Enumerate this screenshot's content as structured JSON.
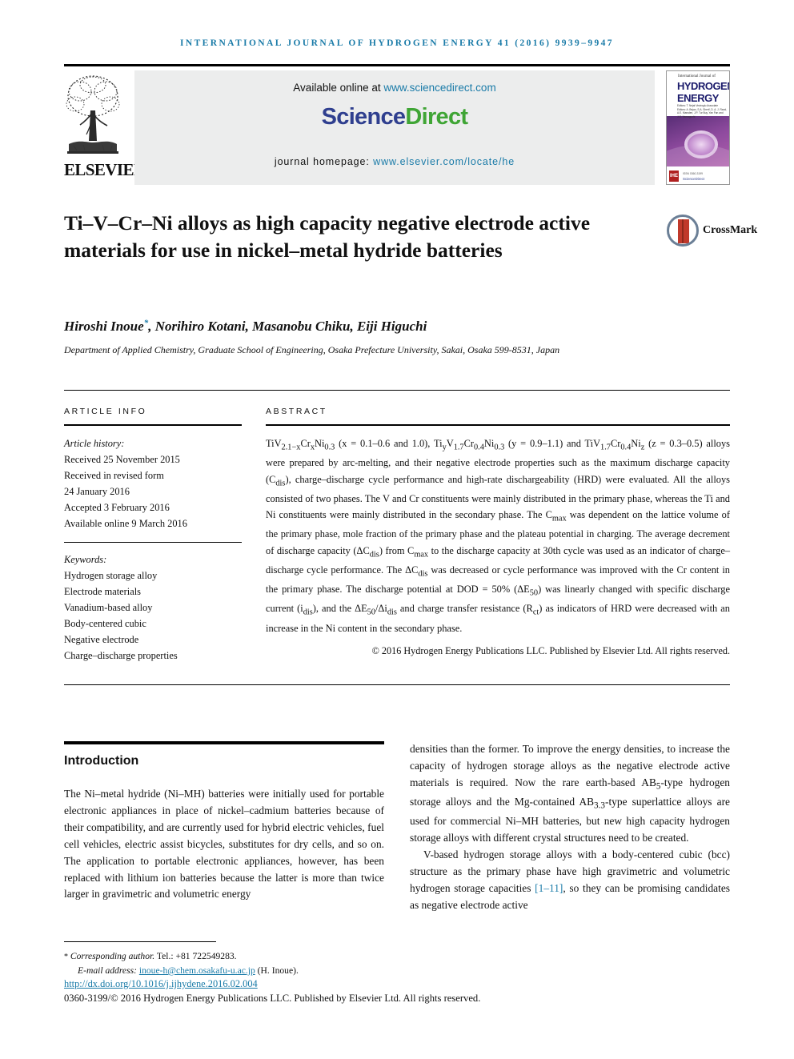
{
  "running_head": "International Journal of Hydrogen Energy 41 (2016) 9939–9947",
  "banner": {
    "publisher": "ELSEVIER",
    "available_text": "Available online at ",
    "available_url": "www.sciencedirect.com",
    "logo_part1": "Science",
    "logo_part2": "Direct",
    "homepage_label": "journal homepage: ",
    "homepage_url": "www.elsevier.com/locate/he",
    "cover": {
      "kicker": "International Journal of",
      "line1": "HYDROGEN",
      "line2": "ENERGY",
      "editors": "Editors: T. Nejat Veziroglu\nAssociate Editors: A. Bejan, S.A. Sherif, D. A. J. Rand, A.E. Marsden, J.P. Tur Buy, Yan Fan and J.O. Yamaguchi",
      "issn_text": "ISSN 0360-3199",
      "sd_text": "ScienceDirect",
      "badge": "IHE"
    }
  },
  "article": {
    "title": "Ti–V–Cr–Ni alloys as high capacity negative electrode active materials for use in nickel–metal hydride batteries",
    "crossmark_label": "CrossMark",
    "authors": "Hiroshi Inoue, Norihiro Kotani, Masanobu Chiku, Eiji Higuchi",
    "corresponding_marker": "*",
    "affiliation": "Department of Applied Chemistry, Graduate School of Engineering, Osaka Prefecture University, Sakai, Osaka 599-8531, Japan"
  },
  "article_info": {
    "heading": "Article info",
    "history_label": "Article history:",
    "history": [
      "Received 25 November 2015",
      "Received in revised form",
      "24 January 2016",
      "Accepted 3 February 2016",
      "Available online 9 March 2016"
    ],
    "keywords_label": "Keywords:",
    "keywords": [
      "Hydrogen storage alloy",
      "Electrode materials",
      "Vanadium-based alloy",
      "Body-centered cubic",
      "Negative electrode",
      "Charge–discharge properties"
    ]
  },
  "abstract": {
    "heading": "Abstract",
    "text_segments": [
      {
        "t": "TiV"
      },
      {
        "t": "2.1−x",
        "s": "sub"
      },
      {
        "t": "Cr"
      },
      {
        "t": "x",
        "s": "sub"
      },
      {
        "t": "Ni"
      },
      {
        "t": "0.3",
        "s": "sub"
      },
      {
        "t": " (x = 0.1–0.6 and 1.0), Ti"
      },
      {
        "t": "y",
        "s": "sub"
      },
      {
        "t": "V"
      },
      {
        "t": "1.7",
        "s": "sub"
      },
      {
        "t": "Cr"
      },
      {
        "t": "0.4",
        "s": "sub"
      },
      {
        "t": "Ni"
      },
      {
        "t": "0.3",
        "s": "sub"
      },
      {
        "t": " (y = 0.9–1.1) and TiV"
      },
      {
        "t": "1.7",
        "s": "sub"
      },
      {
        "t": "Cr"
      },
      {
        "t": "0.4",
        "s": "sub"
      },
      {
        "t": "Ni"
      },
      {
        "t": "z",
        "s": "sub"
      },
      {
        "t": " (z = 0.3–0.5) alloys were prepared by arc-melting, and their negative electrode properties such as the maximum discharge capacity (C"
      },
      {
        "t": "dis",
        "s": "sub"
      },
      {
        "t": "), charge–discharge cycle performance and high-rate dischargeability (HRD) were evaluated. All the alloys consisted of two phases. The V and Cr constituents were mainly distributed in the primary phase, whereas the Ti and Ni constituents were mainly distributed in the secondary phase. The C"
      },
      {
        "t": "max",
        "s": "sub"
      },
      {
        "t": " was dependent on the lattice volume of the primary phase, mole fraction of the primary phase and the plateau potential in charging. The average decrement of discharge capacity (ΔC"
      },
      {
        "t": "dis",
        "s": "sub"
      },
      {
        "t": ") from C"
      },
      {
        "t": "max",
        "s": "sub"
      },
      {
        "t": " to the discharge capacity at 30th cycle was used as an indicator of charge–discharge cycle performance. The ΔC"
      },
      {
        "t": "dis",
        "s": "sub"
      },
      {
        "t": " was decreased or cycle performance was improved with the Cr content in the primary phase. The discharge potential at DOD = 50% (ΔE"
      },
      {
        "t": "50",
        "s": "sub"
      },
      {
        "t": ") was linearly changed with specific discharge current (i"
      },
      {
        "t": "dis",
        "s": "sub"
      },
      {
        "t": "), and the ΔE"
      },
      {
        "t": "50",
        "s": "sub"
      },
      {
        "t": "/Δi"
      },
      {
        "t": "dis",
        "s": "sub"
      },
      {
        "t": " and charge transfer resistance (R"
      },
      {
        "t": "ct",
        "s": "sub"
      },
      {
        "t": ") as indicators of HRD were decreased with an increase in the Ni content in the secondary phase."
      }
    ],
    "copyright": "© 2016 Hydrogen Energy Publications LLC. Published by Elsevier Ltd. All rights reserved."
  },
  "body": {
    "intro_heading": "Introduction",
    "left_paragraph": "The Ni–metal hydride (Ni–MH) batteries were initially used for portable electronic appliances in place of nickel–cadmium batteries because of their compatibility, and are currently used for hybrid electric vehicles, fuel cell vehicles, electric assist bicycles, substitutes for dry cells, and so on. The application to portable electronic appliances, however, has been replaced with lithium ion batteries because the latter is more than twice larger in gravimetric and volumetric energy",
    "right_paragraph_1_segments": [
      {
        "t": "densities than the former. To improve the energy densities, to increase the capacity of hydrogen storage alloys as the negative electrode active materials is required. Now the rare earth-based AB"
      },
      {
        "t": "5",
        "s": "sub"
      },
      {
        "t": "-type hydrogen storage alloys and the Mg-contained AB"
      },
      {
        "t": "3.3",
        "s": "sub"
      },
      {
        "t": "-type superlattice alloys are used for commercial Ni–MH batteries, but new high capacity hydrogen storage alloys with different crystal structures need to be created."
      }
    ],
    "right_paragraph_2_pre": "V-based hydrogen storage alloys with a body-centered cubic (bcc) structure as the primary phase have high gravimetric and volumetric hydrogen storage capacities ",
    "right_paragraph_2_ref": "[1–11]",
    "right_paragraph_2_post": ", so they can be promising candidates as negative electrode active"
  },
  "footer": {
    "corresponding_star": "*",
    "corresponding_label": "Corresponding author.",
    "tel": " Tel.: +81 722549283.",
    "email_label": "E-mail address: ",
    "email": "inoue-h@chem.osakafu-u.ac.jp",
    "email_suffix": " (H. Inoue).",
    "doi": "http://dx.doi.org/10.1016/j.ijhydene.2016.02.004",
    "issn_line": "0360-3199/© 2016 Hydrogen Energy Publications LLC. Published by Elsevier Ltd. All rights reserved."
  },
  "colors": {
    "link": "#1a7ba8",
    "sciencedirect_blue": "#2f3f8f",
    "sciencedirect_green": "#3fa535",
    "banner_bg": "#eceded"
  }
}
